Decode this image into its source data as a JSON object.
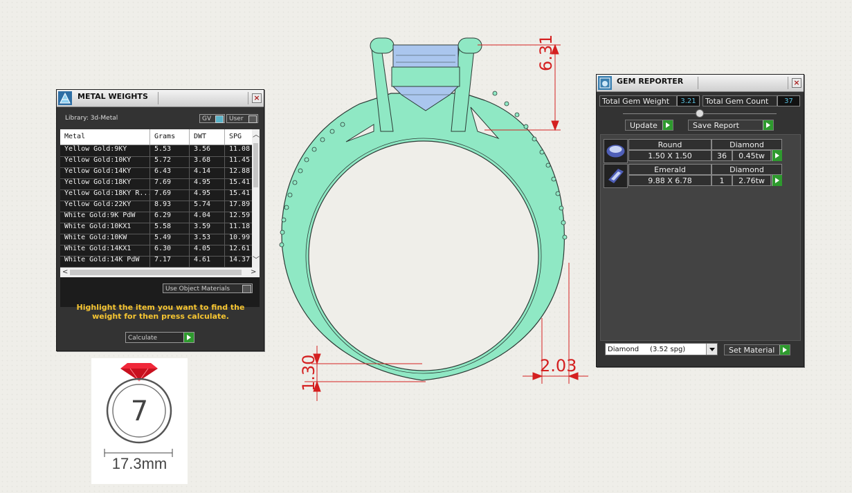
{
  "metal_weights": {
    "title": "METAL WEIGHTS",
    "close_icon": "×",
    "library_label": "Library: 3d-Metal",
    "toggle_gv": "GV",
    "toggle_user": "User",
    "columns": [
      "Metal",
      "Grams",
      "DWT",
      "SPG"
    ],
    "rows": [
      [
        "Yellow Gold:9KY",
        "5.53",
        "3.56",
        "11.08"
      ],
      [
        "Yellow Gold:10KY",
        "5.72",
        "3.68",
        "11.45"
      ],
      [
        "Yellow Gold:14KY",
        "6.43",
        "4.14",
        "12.88"
      ],
      [
        "Yellow Gold:18KY",
        "7.69",
        "4.95",
        "15.41"
      ],
      [
        "Yellow Gold:18KY R...",
        "7.69",
        "4.95",
        "15.41"
      ],
      [
        "Yellow Gold:22KY",
        "8.93",
        "5.74",
        "17.89"
      ],
      [
        "White Gold:9K PdW",
        "6.29",
        "4.04",
        "12.59"
      ],
      [
        "White Gold:10KX1",
        "5.58",
        "3.59",
        "11.18"
      ],
      [
        "White Gold:10KW",
        "5.49",
        "3.53",
        "10.99"
      ],
      [
        "White Gold:14KX1",
        "6.30",
        "4.05",
        "12.61"
      ],
      [
        "White Gold:14K PdW",
        "7.17",
        "4.61",
        "14.37"
      ]
    ],
    "use_object_materials": "Use Object Materials",
    "hint": "Highlight the item you want to find the weight for then press calculate.",
    "calculate_label": "Calculate"
  },
  "gem_reporter": {
    "title": "GEM REPORTER",
    "close_icon": "×",
    "total_weight_label": "Total Gem Weight",
    "total_weight_value": "3.21",
    "total_count_label": "Total Gem Count",
    "total_count_value": "37",
    "update_label": "Update",
    "save_report_label": "Save Report",
    "gems": [
      {
        "shape": "Round",
        "material": "Diamond",
        "size": "1.50 X 1.50",
        "count": "36",
        "weight": "0.45tw"
      },
      {
        "shape": "Emerald",
        "material": "Diamond",
        "size": "9.88 X 6.78",
        "count": "1",
        "weight": "2.76tw"
      }
    ],
    "material_select": "Diamond     (3.52 spg)",
    "set_material_label": "Set Material"
  },
  "drawing": {
    "dim_top": "6.31",
    "dim_bottom_left": "1.30",
    "dim_bottom_right": "2.03"
  },
  "ring_size": {
    "size": "7",
    "diameter": "17.3mm"
  },
  "colors": {
    "ring": "#8fe8c4",
    "gem": "#aac6ee",
    "dimension": "#d42020",
    "accent_ruby": "#e3192a"
  }
}
